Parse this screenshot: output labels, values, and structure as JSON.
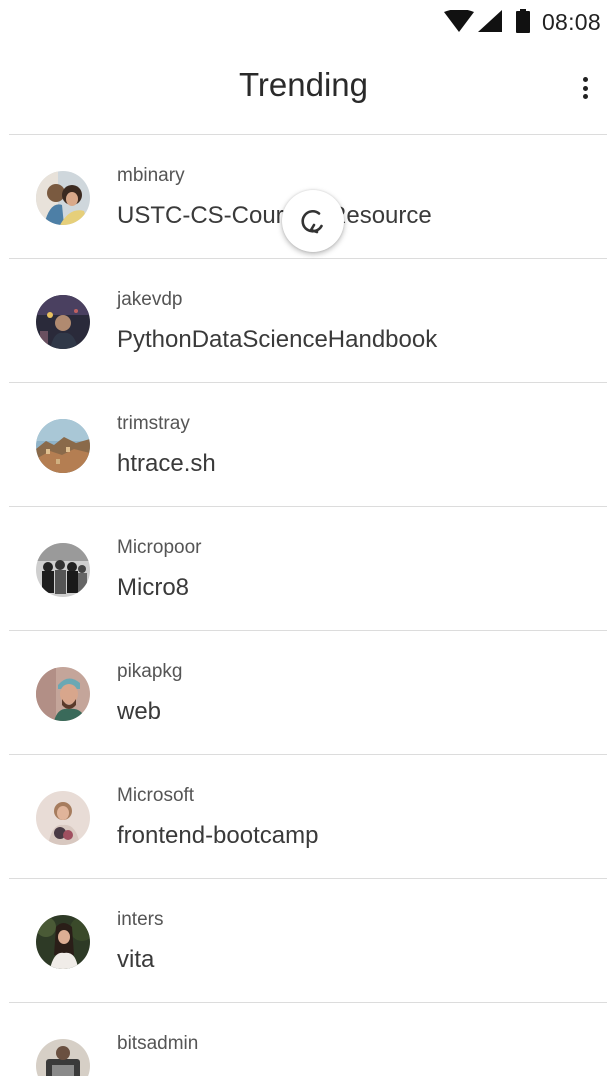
{
  "status_bar": {
    "time": "08:08",
    "icons": [
      "wifi-icon",
      "cellular-signal-icon",
      "battery-icon"
    ]
  },
  "app_bar": {
    "title": "Trending",
    "more_icon": "more-vert-icon"
  },
  "repos": [
    {
      "owner": "mbinary",
      "name": "USTC-CS-Courses-Resource",
      "avatar": "avatar-photo"
    },
    {
      "owner": "jakevdp",
      "name": "PythonDataScienceHandbook",
      "avatar": "avatar-photo"
    },
    {
      "owner": "trimstray",
      "name": "htrace.sh",
      "avatar": "avatar-photo"
    },
    {
      "owner": "Micropoor",
      "name": "Micro8",
      "avatar": "avatar-photo"
    },
    {
      "owner": "pikapkg",
      "name": "web",
      "avatar": "avatar-photo"
    },
    {
      "owner": "Microsoft",
      "name": "frontend-bootcamp",
      "avatar": "avatar-photo"
    },
    {
      "owner": "inters",
      "name": "vita",
      "avatar": "avatar-photo"
    },
    {
      "owner": "bitsadmin",
      "name": "",
      "avatar": "avatar-photo"
    }
  ],
  "refresh_indicator": {
    "icon": "refresh-icon"
  },
  "colors": {
    "background": "#ffffff",
    "divider": "#dcdcdc",
    "title_text": "#2a2a2a",
    "owner_text": "#555555",
    "repo_text": "#3a3a3a"
  }
}
